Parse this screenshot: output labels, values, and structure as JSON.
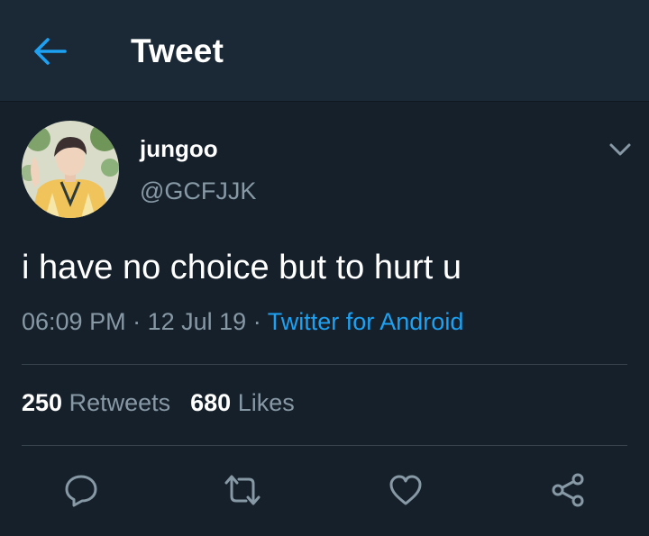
{
  "header": {
    "title": "Tweet",
    "back_icon": "arrow-left-icon",
    "accent_color": "#1da1f2"
  },
  "tweet": {
    "author": {
      "display_name": "jungoo",
      "handle": "@GCFJJK"
    },
    "text": "i have no choice but to hurt u",
    "time": "06:09 PM",
    "date": "12 Jul 19",
    "separator": "·",
    "source": "Twitter for Android"
  },
  "stats": {
    "retweets_count": "250",
    "retweets_label": "Retweets",
    "likes_count": "680",
    "likes_label": "Likes"
  },
  "actions": [
    {
      "icon": "reply-icon"
    },
    {
      "icon": "retweet-icon"
    },
    {
      "icon": "like-heart-icon"
    },
    {
      "icon": "share-icon"
    }
  ],
  "colors": {
    "background": "#15202b",
    "header_background": "#1b2836",
    "secondary_text": "#8899a6",
    "link": "#1da1f2",
    "divider": "#38444d"
  }
}
